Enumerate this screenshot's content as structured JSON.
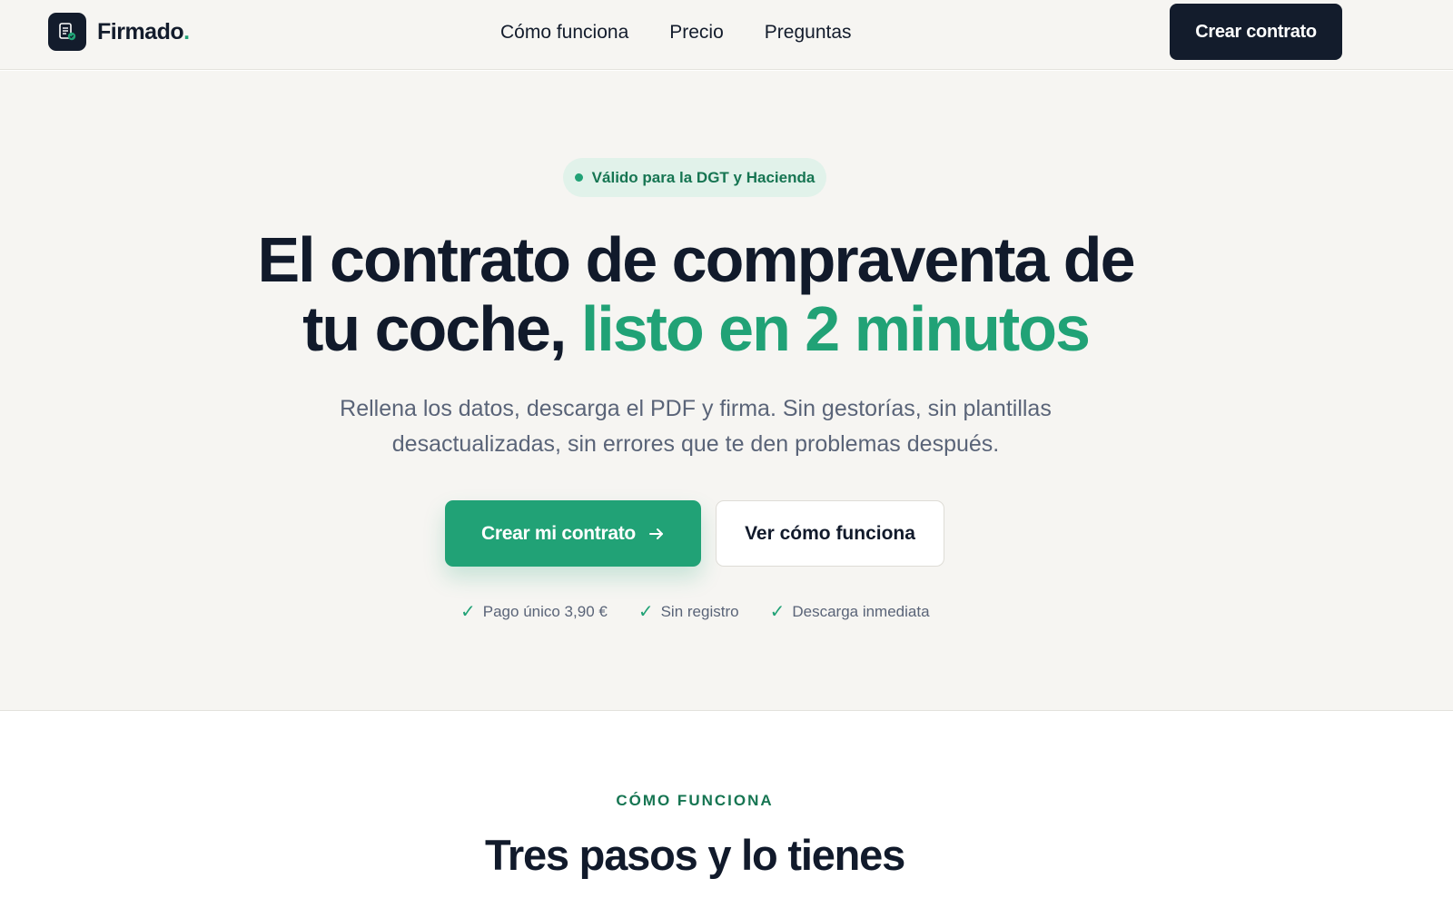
{
  "brand": {
    "name": "Firmado",
    "dot": ".",
    "accent_color": "#21a276",
    "dark_color": "#131c2c",
    "logo_icon": "document-check-icon"
  },
  "nav": {
    "items": [
      {
        "label": "Cómo funciona"
      },
      {
        "label": "Precio"
      },
      {
        "label": "Preguntas"
      }
    ],
    "cta_label": "Crear contrato"
  },
  "hero": {
    "badge": "Válido para la DGT y Hacienda",
    "headline_line1": "El contrato de compraventa de",
    "headline_line2_plain": "tu coche, ",
    "headline_line2_accent": "listo en 2 minutos",
    "subhead_line1": "Rellena los datos, descarga el PDF y firma. Sin gestorías, sin plantillas",
    "subhead_line2": "desactualizadas, sin errores que te den problemas después.",
    "primary_cta": "Crear mi contrato",
    "primary_cta_icon": "arrow-right-icon",
    "secondary_cta": "Ver cómo funciona",
    "perks": [
      {
        "icon": "check-icon",
        "label": "Pago único 3,90 €"
      },
      {
        "icon": "check-icon",
        "label": "Sin registro"
      },
      {
        "icon": "check-icon",
        "label": "Descarga inmediata"
      }
    ]
  },
  "how_it_works": {
    "eyebrow": "CÓMO FUNCIONA",
    "title": "Tres pasos y lo tienes"
  }
}
